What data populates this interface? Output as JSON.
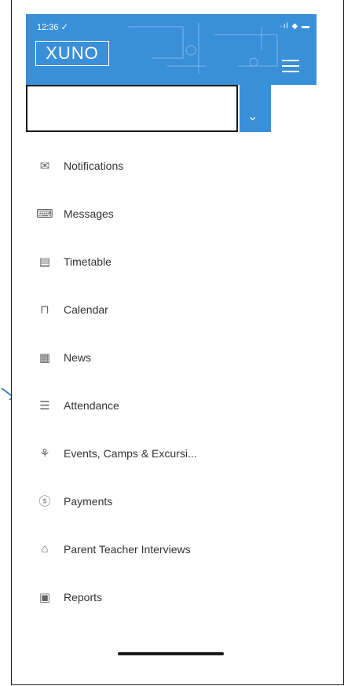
{
  "status_bar": {
    "time": "12:36 ✓",
    "icons": "·ıl ◆ ▬"
  },
  "header": {
    "logo": "XUNO",
    "menu_icon": "hamburger-icon",
    "color": "#3a8fd9"
  },
  "student_selector": {
    "value": "",
    "chevron_icon": "chevron-down-icon"
  },
  "menu": {
    "items": [
      {
        "label": "Notifications",
        "icon": "notification-icon"
      },
      {
        "label": "Messages",
        "icon": "messages-icon"
      },
      {
        "label": "Timetable",
        "icon": "timetable-icon"
      },
      {
        "label": "Calendar",
        "icon": "calendar-icon"
      },
      {
        "label": "News",
        "icon": "news-icon"
      },
      {
        "label": "Attendance",
        "icon": "attendance-icon"
      },
      {
        "label": "Events, Camps & Excursi...",
        "icon": "events-icon"
      },
      {
        "label": "Payments",
        "icon": "payments-icon"
      },
      {
        "label": "Parent Teacher Interviews",
        "icon": "interviews-icon"
      },
      {
        "label": "Reports",
        "icon": "reports-icon"
      }
    ]
  }
}
